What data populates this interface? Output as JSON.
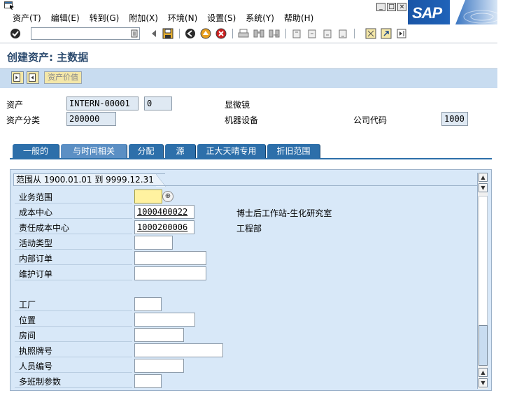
{
  "menubar": {
    "items": [
      "资产(T)",
      "编辑(E)",
      "转到(G)",
      "附加(X)",
      "环境(N)",
      "设置(S)",
      "系统(Y)",
      "帮助(H)"
    ],
    "logo_text": "SAP"
  },
  "toolbar": {
    "command_field_value": ""
  },
  "title": "创建资产: 主数据",
  "app_toolbar": {
    "asset_value_button": "资产价值"
  },
  "header": {
    "asset_label": "资产",
    "asset_number": "INTERN-00001",
    "asset_subnumber": "0",
    "asset_description": "显微镜",
    "asset_class_label": "资产分类",
    "asset_class_value": "200000",
    "asset_class_description": "机器设备",
    "company_code_label": "公司代码",
    "company_code_value": "1000"
  },
  "tabs": [
    {
      "label": "一般的",
      "active": false
    },
    {
      "label": "与时间相关",
      "active": true
    },
    {
      "label": "分配",
      "active": false
    },
    {
      "label": "源",
      "active": false
    },
    {
      "label": "正大天晴专用",
      "active": false
    },
    {
      "label": "折旧范围",
      "active": false
    }
  ],
  "panel": {
    "group_title": "范围从 1900.01.01 到 9999.12.31",
    "fields": [
      {
        "label": "业务范围",
        "value": "",
        "description": ""
      },
      {
        "label": "成本中心",
        "value": "1000400022",
        "description": "博士后工作站-生化研究室"
      },
      {
        "label": "责任成本中心",
        "value": "1000200006",
        "description": "工程部"
      },
      {
        "label": "活动类型",
        "value": "",
        "description": ""
      },
      {
        "label": "内部订单",
        "value": "",
        "description": ""
      },
      {
        "label": "维护订单",
        "value": "",
        "description": ""
      },
      {
        "label": "工厂",
        "value": "",
        "description": ""
      },
      {
        "label": "位置",
        "value": "",
        "description": ""
      },
      {
        "label": "房间",
        "value": "",
        "description": ""
      },
      {
        "label": "执照牌号",
        "value": "",
        "description": ""
      },
      {
        "label": "人员编号",
        "value": "",
        "description": ""
      },
      {
        "label": "多班制参数",
        "value": "",
        "description": ""
      }
    ]
  }
}
